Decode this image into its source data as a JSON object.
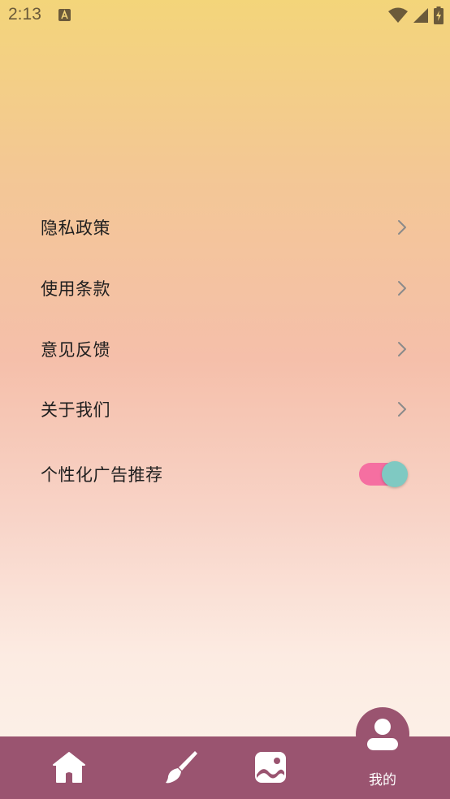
{
  "status_bar": {
    "time": "2:13",
    "notification_icon": "a-notification-icon",
    "icons": [
      "wifi-icon",
      "signal-icon",
      "battery-charging-icon"
    ]
  },
  "settings": {
    "items": [
      {
        "label": "隐私政策",
        "icon": "chevron-right-icon"
      },
      {
        "label": "使用条款",
        "icon": "chevron-right-icon"
      },
      {
        "label": "意见反馈",
        "icon": "chevron-right-icon"
      },
      {
        "label": "关于我们",
        "icon": "chevron-right-icon"
      }
    ],
    "toggle_item": {
      "label": "个性化广告推荐",
      "enabled": true
    }
  },
  "bottom_nav": {
    "items": [
      {
        "icon": "home-icon",
        "label": ""
      },
      {
        "icon": "brush-icon",
        "label": ""
      },
      {
        "icon": "image-icon",
        "label": ""
      },
      {
        "icon": "person-icon",
        "label": "我的",
        "active": true
      }
    ]
  },
  "colors": {
    "nav_bg": "#9a5470",
    "toggle_track": "#f56fa1",
    "toggle_thumb": "#7fc9c2",
    "text_primary": "#1f1f1f",
    "chevron": "#8a8a8a"
  }
}
